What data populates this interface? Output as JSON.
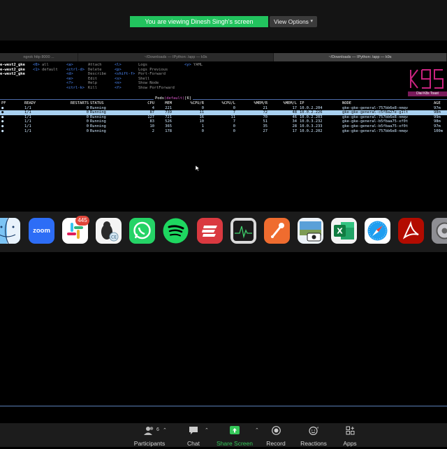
{
  "zoom_top": {
    "share_banner": "You are viewing Dinesh Singh's screen",
    "view_options": "View Options"
  },
  "terminal": {
    "tabs": [
      {
        "label": "ngrok http 8000 ..."
      },
      {
        "label": "~/Downloads — IPython: /app — k9s"
      },
      {
        "label": "~/Downloads — IPython: /app — k9s"
      }
    ],
    "contexts": [
      "e-west2_gke",
      "e-west2_gke",
      "e-west2_gke"
    ],
    "namespaces": [
      {
        "key": "<0>",
        "label": "all"
      },
      {
        "key": "<1>",
        "label": "default"
      }
    ],
    "shortcuts_col1": [
      {
        "key": "<a>",
        "label": "Attach"
      },
      {
        "key": "<ctrl-d>",
        "label": "Delete"
      },
      {
        "key": "<d>",
        "label": "Describe"
      },
      {
        "key": "<e>",
        "label": "Edit"
      },
      {
        "key": "<?>",
        "label": "Help"
      },
      {
        "key": "<ctrl-k>",
        "label": "Kill"
      }
    ],
    "shortcuts_col2": [
      {
        "key": "<l>",
        "label": "Logs"
      },
      {
        "key": "<p>",
        "label": "Logs Previous"
      },
      {
        "key": "<shift-f>",
        "label": "Port-Forward"
      },
      {
        "key": "<s>",
        "label": "Shell"
      },
      {
        "key": "<n>",
        "label": "Show Node"
      },
      {
        "key": "<f>",
        "label": "Show PortForward"
      }
    ],
    "shortcuts_col3": [
      {
        "key": "<y>",
        "label": "YAML"
      }
    ],
    "logo_sub": "Dial K8s Toast",
    "pods_title": {
      "resource": "Pods",
      "namespace": "(default)",
      "count": "[6]"
    },
    "columns": [
      "PF",
      "READY",
      "RESTARTS",
      "STATUS",
      "CPU",
      "MEM",
      "%CPU/R",
      "%CPU/L",
      "%MEM/R",
      "%MEM/L",
      "IP",
      "NODE",
      "AGE"
    ],
    "rows": [
      [
        "●",
        "1/1",
        "0",
        "Running",
        "4",
        "221",
        "0",
        "0",
        "21",
        "17",
        "10.0.2.204",
        "gke-gke-general-757bb6e8-nmqv",
        "97m"
      ],
      [
        "●",
        "1/1",
        "0",
        "Running",
        "87",
        "739",
        "11",
        "7",
        "72",
        "48",
        "10.0.2.226",
        "gke-gke-general-c5f8a27e-g1lt",
        "98m"
      ],
      [
        "●",
        "1/1",
        "0",
        "Running",
        "127",
        "721",
        "16",
        "11",
        "70",
        "46",
        "10.0.2.203",
        "gke-gke-general-757bb6e8-nmqv",
        "99m"
      ],
      [
        "●",
        "1/1",
        "0",
        "Running",
        "83",
        "526",
        "10",
        "7",
        "51",
        "34",
        "10.0.3.232",
        "gke-gke-general-b5fbaa75-xf0t",
        "98m"
      ],
      [
        "●",
        "1/1",
        "0",
        "Running",
        "10",
        "365",
        "1",
        "0",
        "35",
        "28",
        "10.0.3.233",
        "gke-gke-general-b5fbaa75-xf0t",
        "97m"
      ],
      [
        "●",
        "1/1",
        "0",
        "Running",
        "2",
        "178",
        "0",
        "0",
        "27",
        "17",
        "10.0.2.202",
        "gke-gke-general-757bb6e8-nmqv",
        "100m"
      ]
    ],
    "selected_row": 1
  },
  "dock": {
    "apps": [
      "finder-icon",
      "zoom-icon",
      "slack-icon",
      "cyberduck-icon",
      "whatsapp-icon",
      "spotify-icon",
      "expressvpn-icon",
      "activity-monitor-icon",
      "postman-icon",
      "preview-icon",
      "excel-icon",
      "safari-icon",
      "acrobat-icon",
      "settings-icon"
    ],
    "zoom_label": "zoom",
    "slack_badge": "445"
  },
  "toolbar": {
    "participants_label": "Participants",
    "participants_count": "6",
    "chat_label": "Chat",
    "share_label": "Share Screen",
    "record_label": "Record",
    "reactions_label": "Reactions",
    "apps_label": "Apps"
  },
  "colors": {
    "share_green": "#22c35e",
    "selection": "#a8d0f0",
    "shortcut_key": "#4f8cff"
  }
}
